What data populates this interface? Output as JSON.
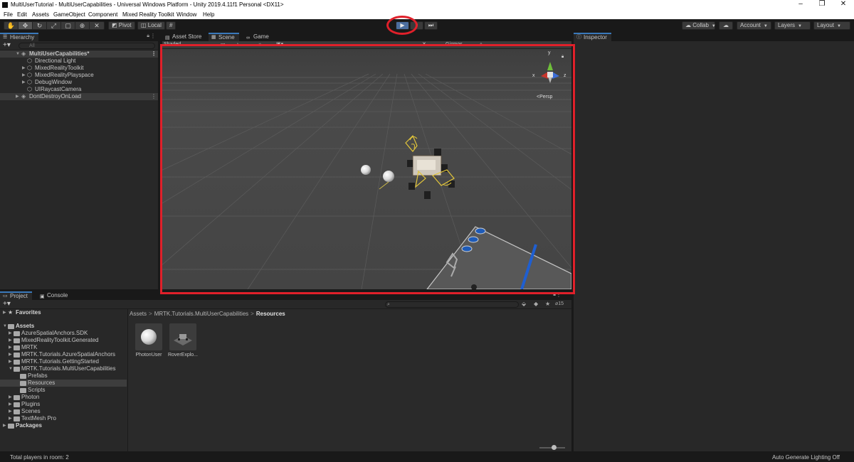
{
  "window": {
    "title": "MultiUserTutorial - MultiUserCapabilities - Universal Windows Platform - Unity 2019.4.11f1 Personal <DX11>",
    "minimize": "–",
    "maximize": "❐",
    "close": "✕"
  },
  "menu": [
    "File",
    "Edit",
    "Assets",
    "GameObject",
    "Component",
    "Mixed Reality Toolkit",
    "Window",
    "Help"
  ],
  "toolbar": {
    "pivot": "Pivot",
    "local": "Local",
    "play": "▶",
    "pause": "⏸",
    "step": "⏭",
    "collab": "Collab",
    "account": "Account",
    "layers": "Layers",
    "layout": "Layout"
  },
  "hierarchy": {
    "tab": "Hierarchy",
    "search_placeholder": "All",
    "rows": [
      {
        "label": "MultiUserCapabilities*"
      },
      {
        "label": "Directional Light"
      },
      {
        "label": "MixedRealityToolkit"
      },
      {
        "label": "MixedRealityPlayspace"
      },
      {
        "label": "DebugWindow"
      },
      {
        "label": "UIRaycastCamera"
      },
      {
        "label": "DontDestroyOnLoad"
      }
    ]
  },
  "center_tabs": [
    "Asset Store",
    "Scene",
    "Game"
  ],
  "scene_view": {
    "shading": "Shaded",
    "gizmos": "Gizmos",
    "persp": "Persp",
    "axis_y": "y",
    "axis_x": "x",
    "axis_z": "z"
  },
  "inspector": {
    "tab": "Inspector"
  },
  "project": {
    "tabs": [
      "Project",
      "Console"
    ],
    "hidden_count": "15",
    "favorites": "Favorites",
    "tree": [
      {
        "label": "Assets"
      },
      {
        "label": "AzureSpatialAnchors.SDK"
      },
      {
        "label": "MixedRealityToolkit.Generated"
      },
      {
        "label": "MRTK"
      },
      {
        "label": "MRTK.Tutorials.AzureSpatialAnchors"
      },
      {
        "label": "MRTK.Tutorials.GettingStarted"
      },
      {
        "label": "MRTK.Tutorials.MultiUserCapabilities"
      },
      {
        "label": "Prefabs"
      },
      {
        "label": "Resources"
      },
      {
        "label": "Scripts"
      },
      {
        "label": "Photon"
      },
      {
        "label": "Plugins"
      },
      {
        "label": "Scenes"
      },
      {
        "label": "TextMesh Pro"
      },
      {
        "label": "Packages"
      }
    ],
    "breadcrumb": [
      "Assets",
      "MRTK.Tutorials.MultiUserCapabilities",
      "Resources"
    ],
    "assets": [
      "PhotonUser",
      "RoverExplo..."
    ]
  },
  "status": {
    "left": "Total players in room: 2",
    "right": "Auto Generate Lighting Off"
  },
  "colors": {
    "accent": "#3a79bb",
    "highlight": "#e0202a",
    "play_active": "#4c6e9f"
  }
}
